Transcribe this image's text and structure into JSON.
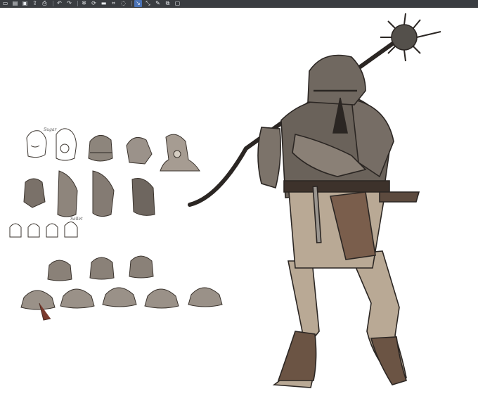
{
  "toolbar": {
    "buttons": [
      {
        "name": "new-file-icon",
        "glyph": "▭",
        "active": false
      },
      {
        "name": "open-file-icon",
        "glyph": "▤",
        "active": false
      },
      {
        "name": "save-icon",
        "glyph": "▣",
        "active": false
      },
      {
        "name": "export-icon",
        "glyph": "⇪",
        "active": false
      },
      {
        "name": "print-icon",
        "glyph": "⎙",
        "active": false
      },
      {
        "name": "undo-icon",
        "glyph": "↶",
        "active": false
      },
      {
        "name": "redo-icon",
        "glyph": "↷",
        "active": false
      },
      {
        "name": "loading-icon",
        "glyph": "✲",
        "active": false
      },
      {
        "name": "clear-icon",
        "glyph": "⟳",
        "active": false
      },
      {
        "name": "fill-icon",
        "glyph": "▬",
        "active": false
      },
      {
        "name": "crop-icon",
        "glyph": "⌗",
        "active": false
      },
      {
        "name": "lasso-icon",
        "glyph": "◌",
        "active": false
      },
      {
        "name": "move-icon",
        "glyph": "↘",
        "active": true
      },
      {
        "name": "transform-icon",
        "glyph": "⤡",
        "active": false
      },
      {
        "name": "pen-icon",
        "glyph": "✎",
        "active": false
      },
      {
        "name": "layer-icon",
        "glyph": "⧉",
        "active": false
      },
      {
        "name": "window-icon",
        "glyph": "▢",
        "active": false
      }
    ]
  },
  "canvas": {
    "sketch_labels": [
      "Sugar",
      "Sallet"
    ]
  },
  "colors": {
    "toolbar_bg": "#3a3d41",
    "armor_dark": "#6a625a",
    "armor_mid": "#8a8076",
    "cloth": "#b9a995",
    "leather": "#6b5444",
    "outline": "#2b2623"
  }
}
